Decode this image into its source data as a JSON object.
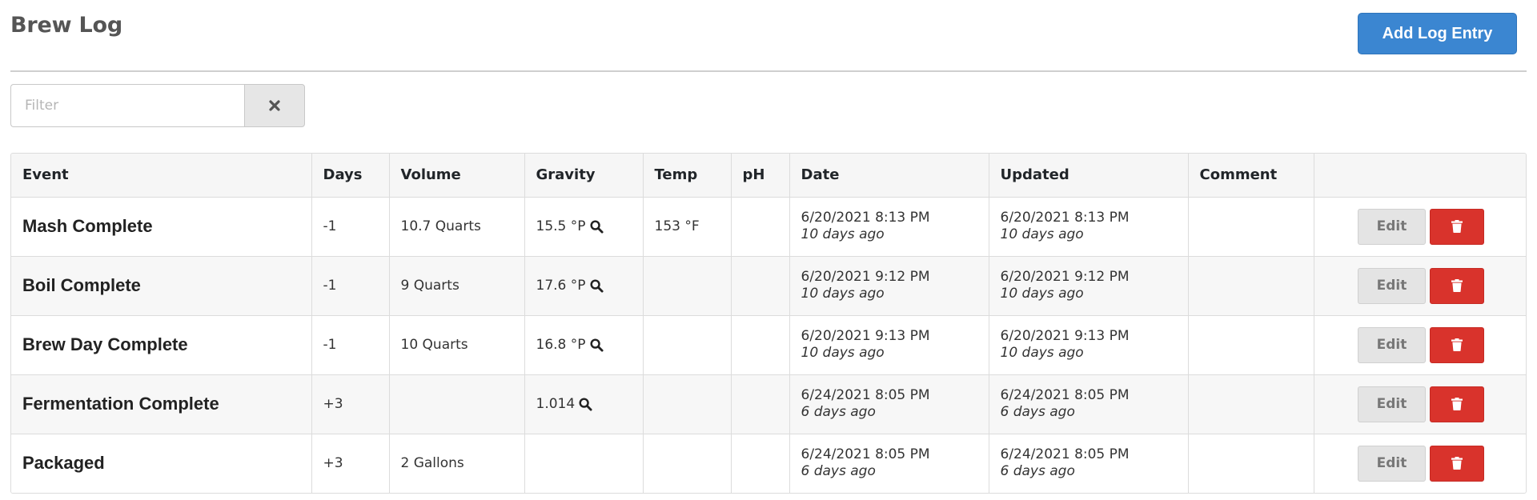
{
  "header": {
    "title": "Brew Log",
    "add_button_label": "Add Log Entry"
  },
  "filter": {
    "placeholder": "Filter",
    "value": ""
  },
  "table": {
    "columns": [
      "Event",
      "Days",
      "Volume",
      "Gravity",
      "Temp",
      "pH",
      "Date",
      "Updated",
      "Comment",
      ""
    ],
    "rows": [
      {
        "event": "Mash Complete",
        "days": "-1",
        "volume": "10.7 Quarts",
        "gravity": "15.5 °P",
        "temp": "153 °F",
        "ph": "",
        "date": "6/20/2021 8:13 PM",
        "date_rel": "10 days ago",
        "updated": "6/20/2021 8:13 PM",
        "updated_rel": "10 days ago",
        "comment": ""
      },
      {
        "event": "Boil Complete",
        "days": "-1",
        "volume": "9 Quarts",
        "gravity": "17.6 °P",
        "temp": "",
        "ph": "",
        "date": "6/20/2021 9:12 PM",
        "date_rel": "10 days ago",
        "updated": "6/20/2021 9:12 PM",
        "updated_rel": "10 days ago",
        "comment": ""
      },
      {
        "event": "Brew Day Complete",
        "days": "-1",
        "volume": "10 Quarts",
        "gravity": "16.8 °P",
        "temp": "",
        "ph": "",
        "date": "6/20/2021 9:13 PM",
        "date_rel": "10 days ago",
        "updated": "6/20/2021 9:13 PM",
        "updated_rel": "10 days ago",
        "comment": ""
      },
      {
        "event": "Fermentation Complete",
        "days": "+3",
        "volume": "",
        "gravity": "1.014",
        "temp": "",
        "ph": "",
        "date": "6/24/2021 8:05 PM",
        "date_rel": "6 days ago",
        "updated": "6/24/2021 8:05 PM",
        "updated_rel": "6 days ago",
        "comment": ""
      },
      {
        "event": "Packaged",
        "days": "+3",
        "volume": "2 Gallons",
        "gravity": "",
        "temp": "",
        "ph": "",
        "date": "6/24/2021 8:05 PM",
        "date_rel": "6 days ago",
        "updated": "6/24/2021 8:05 PM",
        "updated_rel": "6 days ago",
        "comment": ""
      }
    ],
    "edit_label": "Edit"
  },
  "icons": {
    "clear": "times-icon",
    "gravity": "magnifier-icon",
    "delete": "trash-icon"
  },
  "colors": {
    "primary": "#3b86d1",
    "danger": "#d9332c",
    "secondary": "#e4e4e4"
  }
}
